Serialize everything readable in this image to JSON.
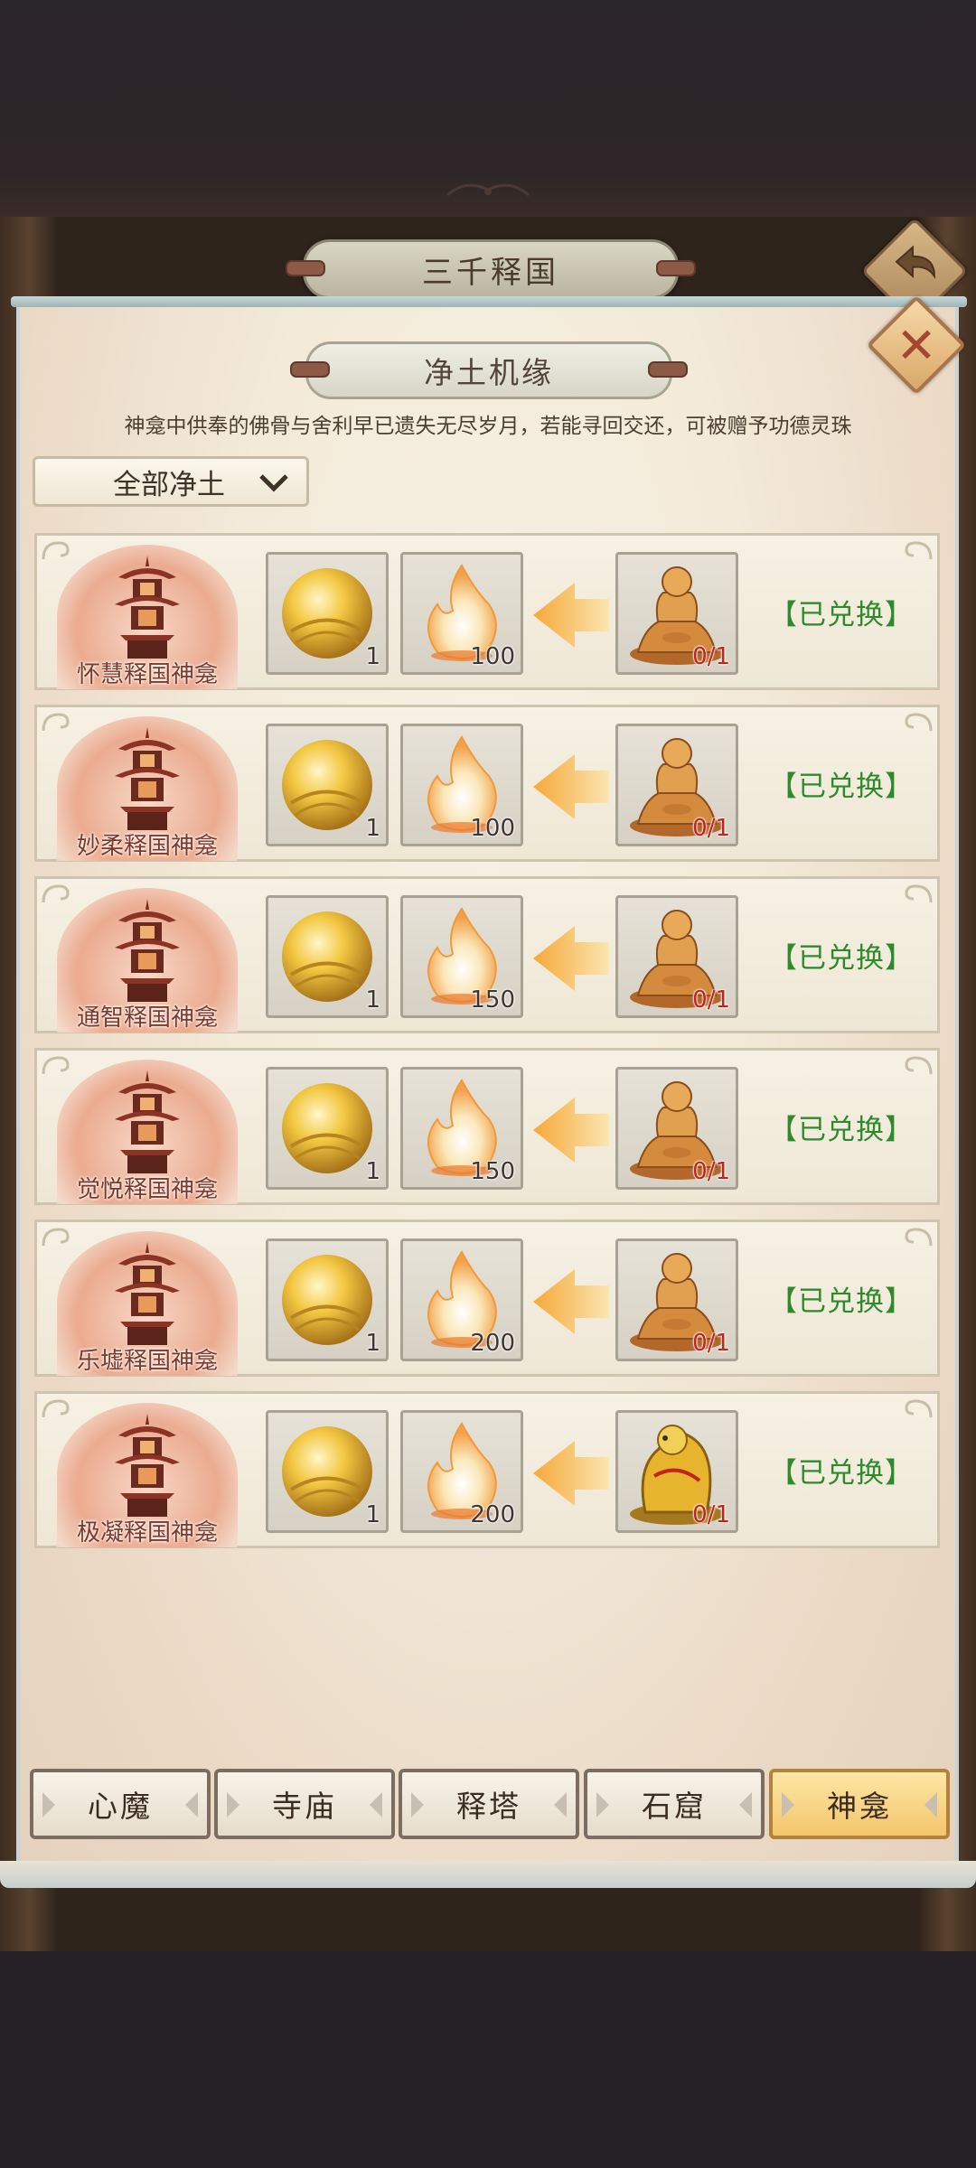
{
  "header": {
    "title": "三千释国",
    "back_icon": "back-arrow-icon"
  },
  "panel": {
    "subtitle": "净土机缘",
    "description": "神龛中供奉的佛骨与舍利早已遗失无尽岁月，若能寻回交还，可被赠予功德灵珠",
    "filter": {
      "selected": "全部净土"
    },
    "close_icon": "close-icon"
  },
  "rows": [
    {
      "name": "怀慧释国神龛",
      "orb_qty": "1",
      "flame_qty": "100",
      "required": "0/1",
      "required_icon": "buddha-statue-icon",
      "status": "【已兑换】"
    },
    {
      "name": "妙柔释国神龛",
      "orb_qty": "1",
      "flame_qty": "100",
      "required": "0/1",
      "required_icon": "buddha-statue-icon",
      "status": "【已兑换】"
    },
    {
      "name": "通智释国神龛",
      "orb_qty": "1",
      "flame_qty": "150",
      "required": "0/1",
      "required_icon": "buddha-statue-icon",
      "status": "【已兑换】"
    },
    {
      "name": "觉悦释国神龛",
      "orb_qty": "1",
      "flame_qty": "150",
      "required": "0/1",
      "required_icon": "buddha-statue-icon",
      "status": "【已兑换】"
    },
    {
      "name": "乐墟释国神龛",
      "orb_qty": "1",
      "flame_qty": "200",
      "required": "0/1",
      "required_icon": "buddha-statue-icon",
      "status": "【已兑换】"
    },
    {
      "name": "极凝释国神龛",
      "orb_qty": "1",
      "flame_qty": "200",
      "required": "0/1",
      "required_icon": "golden-relic-icon",
      "status": "【已兑换】"
    }
  ],
  "tabs": [
    {
      "label": "心魔",
      "active": false
    },
    {
      "label": "寺庙",
      "active": false
    },
    {
      "label": "释塔",
      "active": false
    },
    {
      "label": "石窟",
      "active": false
    },
    {
      "label": "神龛",
      "active": true
    }
  ],
  "colors": {
    "status_green": "#2f8a2c",
    "required_red": "#c3231e",
    "tab_active": "#f3c66c"
  }
}
